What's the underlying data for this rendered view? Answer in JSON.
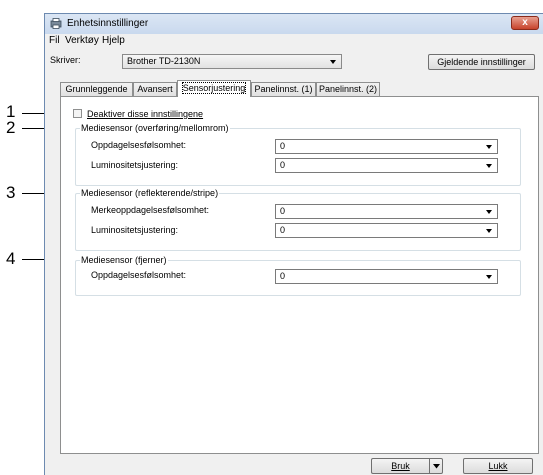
{
  "callouts": [
    "1",
    "2",
    "3",
    "4"
  ],
  "window": {
    "title": "Enhetsinnstillinger",
    "close_glyph": "x"
  },
  "menu": {
    "items": [
      "Fil",
      "Verktøy",
      "Hjelp"
    ]
  },
  "printer": {
    "label": "Skriver:",
    "selected": "Brother TD-2130N",
    "current_settings_button": "Gjeldende innstillinger"
  },
  "tabs": [
    {
      "label": "Grunnleggende",
      "active": false
    },
    {
      "label": "Avansert",
      "active": false
    },
    {
      "label": "Sensorjustering",
      "active": true
    },
    {
      "label": "Panelinnst. (1)",
      "active": false
    },
    {
      "label": "Panelinnst. (2)",
      "active": false
    }
  ],
  "disable_checkbox": {
    "label": "Deaktiver disse innstillingene",
    "checked": false
  },
  "groups": [
    {
      "title": "Mediesensor (overføring/mellomrom)",
      "fields": [
        {
          "label": "Oppdagelsesfølsomhet:",
          "value": "0"
        },
        {
          "label": "Luminositetsjustering:",
          "value": "0"
        }
      ]
    },
    {
      "title": "Mediesensor (reflekterende/stripe)",
      "fields": [
        {
          "label": "Merkeoppdagelsesfølsomhet:",
          "value": "0"
        },
        {
          "label": "Luminositetsjustering:",
          "value": "0"
        }
      ]
    },
    {
      "title": "Mediesensor (fjerner)",
      "fields": [
        {
          "label": "Oppdagelsesfølsomhet:",
          "value": "0"
        }
      ]
    }
  ],
  "footer": {
    "apply_button": "Bruk",
    "close_button": "Lukk"
  },
  "icons": {
    "app": "printer-settings-icon",
    "close": "close-icon",
    "dropdown": "chevron-down-icon"
  }
}
